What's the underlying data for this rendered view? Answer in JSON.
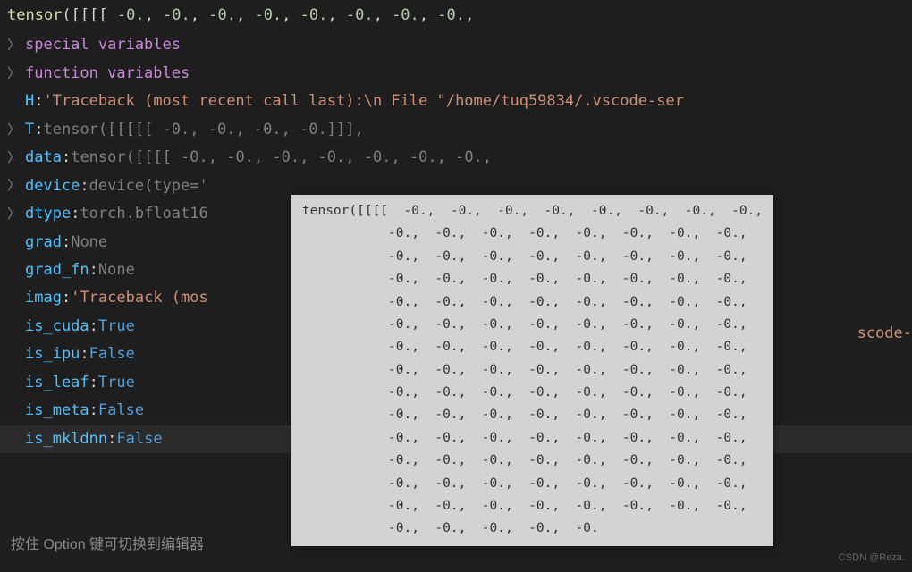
{
  "top_tensor": "tensor([[[[   -0.,     -0.,     -0.,     -0.,     -0.,     -0.,     -0.,     -0.,",
  "rows": {
    "special_vars": "special variables",
    "function_vars": "function variables",
    "H": {
      "key": "H",
      "val": "'Traceback (most recent call last):\\n  File \"/home/tuq59834/.vscode-ser"
    },
    "T": {
      "key": "T",
      "prefix": "tensor",
      "val": "([[[[[   -0.,    -0.,    -0.,    -0.]]],"
    },
    "data": {
      "key": "data",
      "prefix": "tensor",
      "val": "([[[[   -0.,    -0.,    -0.,    -0.,    -0.,    -0.,    -0.,"
    },
    "device": {
      "key": "device",
      "prefix": "device",
      "val": "(type='"
    },
    "dtype": {
      "key": "dtype",
      "val1": "torch",
      "val2": ".bfloat16"
    },
    "grad": {
      "key": "grad",
      "val": "None"
    },
    "grad_fn": {
      "key": "grad_fn",
      "val": "None"
    },
    "imag": {
      "key": "imag",
      "val": "'Traceback (mos"
    },
    "is_cuda": {
      "key": "is_cuda",
      "val": "True"
    },
    "is_ipu": {
      "key": "is_ipu",
      "val": "False"
    },
    "is_leaf": {
      "key": "is_leaf",
      "val": "True"
    },
    "is_meta": {
      "key": "is_meta",
      "val": "False"
    },
    "is_mkldnn": {
      "key": "is_mkldnn",
      "val": "False"
    }
  },
  "bg_overlay": "scode-",
  "footer": "按住 Option 键可切换到编辑器",
  "tooltip_lines": [
    "tensor([[[[  -0.,  -0.,  -0.,  -0.,  -0.,  -0.,  -0.,  -0.,",
    "           -0.,  -0.,  -0.,  -0.,  -0.,  -0.,  -0.,  -0.,",
    "           -0.,  -0.,  -0.,  -0.,  -0.,  -0.,  -0.,  -0.,",
    "           -0.,  -0.,  -0.,  -0.,  -0.,  -0.,  -0.,  -0.,",
    "           -0.,  -0.,  -0.,  -0.,  -0.,  -0.,  -0.,  -0.,",
    "           -0.,  -0.,  -0.,  -0.,  -0.,  -0.,  -0.,  -0.,",
    "           -0.,  -0.,  -0.,  -0.,  -0.,  -0.,  -0.,  -0.,",
    "           -0.,  -0.,  -0.,  -0.,  -0.,  -0.,  -0.,  -0.,",
    "           -0.,  -0.,  -0.,  -0.,  -0.,  -0.,  -0.,  -0.,",
    "           -0.,  -0.,  -0.,  -0.,  -0.,  -0.,  -0.,  -0.,",
    "           -0.,  -0.,  -0.,  -0.,  -0.,  -0.,  -0.,  -0.,",
    "           -0.,  -0.,  -0.,  -0.,  -0.,  -0.,  -0.,  -0.,",
    "           -0.,  -0.,  -0.,  -0.,  -0.,  -0.,  -0.,  -0.,",
    "           -0.,  -0.,  -0.,  -0.,  -0.,  -0.,  -0.,  -0.,",
    "           -0.,  -0.,  -0.,  -0.,  -0."
  ],
  "watermark": "CSDN @Reza."
}
